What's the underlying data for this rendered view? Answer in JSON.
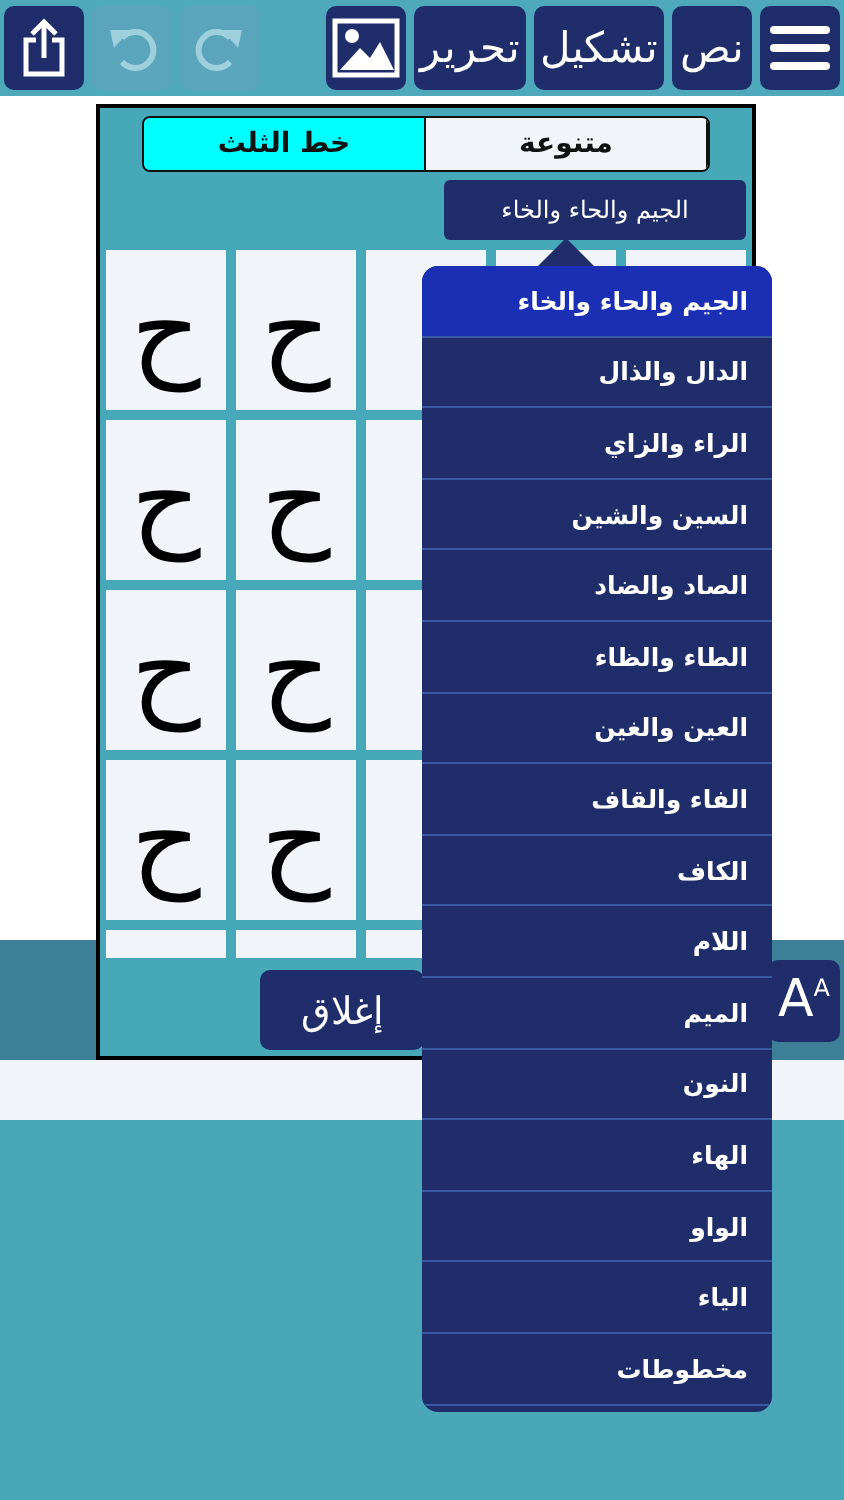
{
  "toolbar": {
    "right_buttons": [
      {
        "kind": "menu"
      },
      {
        "kind": "text",
        "label": "نص"
      },
      {
        "kind": "text",
        "label": "تشكيل"
      },
      {
        "kind": "text",
        "label": "تحرير"
      },
      {
        "kind": "image"
      }
    ],
    "left_buttons": [
      {
        "kind": "redo",
        "disabled": true
      },
      {
        "kind": "undo",
        "disabled": true
      },
      {
        "kind": "share",
        "disabled": false
      }
    ]
  },
  "panel": {
    "tabs": [
      {
        "label": "متنوعة",
        "selected": false
      },
      {
        "label": "خط الثلث",
        "selected": true
      }
    ],
    "dropdown": {
      "value": "الجيم والحاء والخاء"
    },
    "grid_rows": [
      [
        "ح",
        "ح"
      ],
      [
        "ح",
        "ح"
      ],
      [
        "ح",
        "ح"
      ],
      [
        "ح",
        "ح"
      ],
      []
    ],
    "close_button": "إغلاق"
  },
  "font_size_button": {
    "label": "A",
    "superscript": "A"
  },
  "dropdown_menu": {
    "items": [
      {
        "label": "الجيم والحاء والخاء",
        "selected": true
      },
      {
        "label": "الدال والذال",
        "selected": false
      },
      {
        "label": "الراء والزاي",
        "selected": false
      },
      {
        "label": "السين والشين",
        "selected": false
      },
      {
        "label": "الصاد والضاد",
        "selected": false
      },
      {
        "label": "الطاء والظاء",
        "selected": false
      },
      {
        "label": "العين والغين",
        "selected": false
      },
      {
        "label": "الفاء والقاف",
        "selected": false
      },
      {
        "label": "الكاف",
        "selected": false
      },
      {
        "label": "اللام",
        "selected": false
      },
      {
        "label": "الميم",
        "selected": false
      },
      {
        "label": "النون",
        "selected": false
      },
      {
        "label": "الهاء",
        "selected": false
      },
      {
        "label": "الواو",
        "selected": false
      },
      {
        "label": "الياء",
        "selected": false
      },
      {
        "label": "مخطوطات",
        "selected": false
      }
    ]
  }
}
